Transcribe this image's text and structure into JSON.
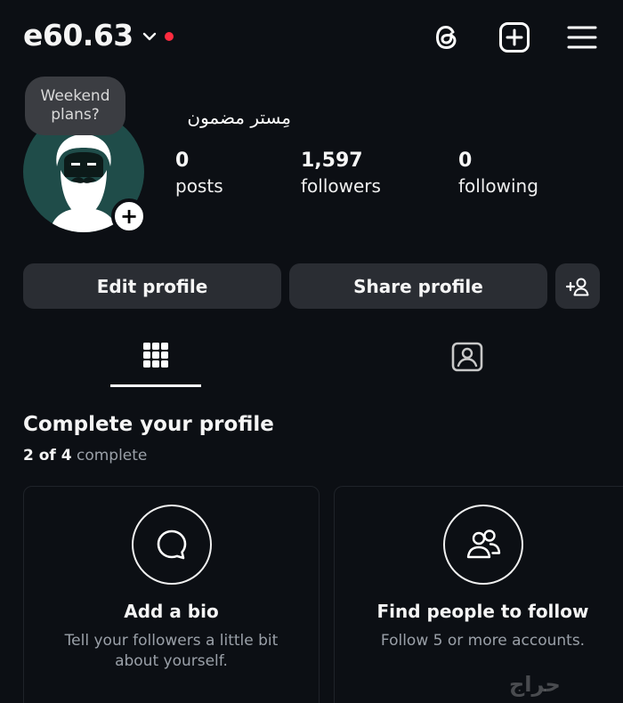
{
  "header": {
    "username": "e60.63",
    "icons": [
      "chevron-down-icon",
      "threads-icon",
      "create-icon",
      "menu-icon"
    ],
    "notification_dot_color": "#ff2b3f"
  },
  "profile": {
    "note": "Weekend plans?",
    "display_name": "مِستر مضمون",
    "stats": [
      {
        "value": "0",
        "label": "posts"
      },
      {
        "value": "1,597",
        "label": "followers"
      },
      {
        "value": "0",
        "label": "following"
      }
    ],
    "avatar_bg": "#1f4c49"
  },
  "actions": {
    "edit_label": "Edit profile",
    "share_label": "Share profile"
  },
  "tabs": [
    {
      "icon": "grid-icon",
      "active": true
    },
    {
      "icon": "tagged-icon",
      "active": false
    }
  ],
  "complete_profile": {
    "title": "Complete your profile",
    "progress_count": "2 of 4",
    "progress_suffix": "complete",
    "cards": [
      {
        "icon": "speech-bubble-icon",
        "title": "Add a bio",
        "description": "Tell your followers a little bit about yourself."
      },
      {
        "icon": "people-icon",
        "title": "Find people to follow",
        "description": "Follow 5 or more accounts."
      }
    ]
  },
  "watermark": "حراج"
}
